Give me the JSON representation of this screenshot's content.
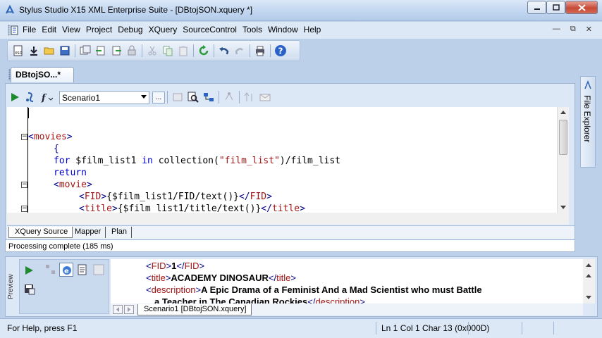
{
  "window": {
    "title": "Stylus Studio X15 XML Enterprise Suite - [DBtojSON.xquery *]",
    "minimize_icon": "minimize-icon",
    "maximize_icon": "maximize-icon",
    "close_icon": "close-icon"
  },
  "menu": {
    "items": [
      "File",
      "Edit",
      "View",
      "Project",
      "Debug",
      "XQuery",
      "SourceControl",
      "Tools",
      "Window",
      "Help"
    ]
  },
  "toolbar": {
    "icons": [
      "new-xsd-icon",
      "download-icon",
      "open-folder-icon",
      "save-icon",
      "copy-window-icon",
      "import-icon",
      "export-icon",
      "lock-icon",
      "cut-icon",
      "copy-icon",
      "paste-icon",
      "refresh-icon",
      "undo-icon",
      "redo-icon",
      "print-icon",
      "help-icon"
    ]
  },
  "document_tab": {
    "label": "DBtojSO...*"
  },
  "editor_toolbar": {
    "scenario_value": "Scenario1",
    "dots_label": "..."
  },
  "code": {
    "lines": [
      "",
      "<movies>",
      "    {",
      "    for $film_list1 in collection(\"film_list\")/film_list",
      "    return",
      "    <movie>",
      "        <FID>{$film_list1/FID/text()}</FID>",
      "        <title>{$film list1/title/text()}</title>"
    ]
  },
  "source_tabs": [
    "XQuery Source",
    "Mapper",
    "Plan"
  ],
  "processing_status": "Processing complete (185 ms)",
  "file_explorer": {
    "label": "File Explorer"
  },
  "preview": {
    "side_label": "Preview",
    "fid_value": "1",
    "title_value": "ACADEMY DINOSAUR",
    "description_value": "A Epic Drama of a Feminist And a Mad Scientist who must Battle",
    "description_value_2": "a Teacher in The Canadian Rockies",
    "tab_label": "Scenario1 [DBtojSON.xquery]"
  },
  "statusbar": {
    "help_text": "For Help, press F1",
    "position_text": "Ln 1 Col 1  Char 13 (0x000D)"
  },
  "colors": {
    "tag": "#a31515",
    "keyword": "#0000d0",
    "title_bg": "#c4d8f1"
  }
}
